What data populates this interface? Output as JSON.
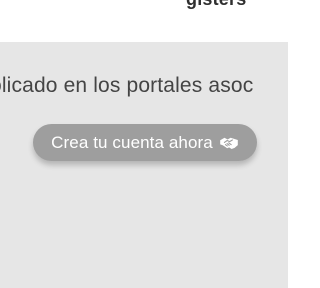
{
  "header": {
    "cut_text": "gisters"
  },
  "panel": {
    "partial_text": "olicado en los portales asoc",
    "cta_label": "Crea tu cuenta ahora",
    "cta_icon": "handshake-icon",
    "background_color": "#e6e6e6",
    "button_color": "#9e9e9e"
  }
}
